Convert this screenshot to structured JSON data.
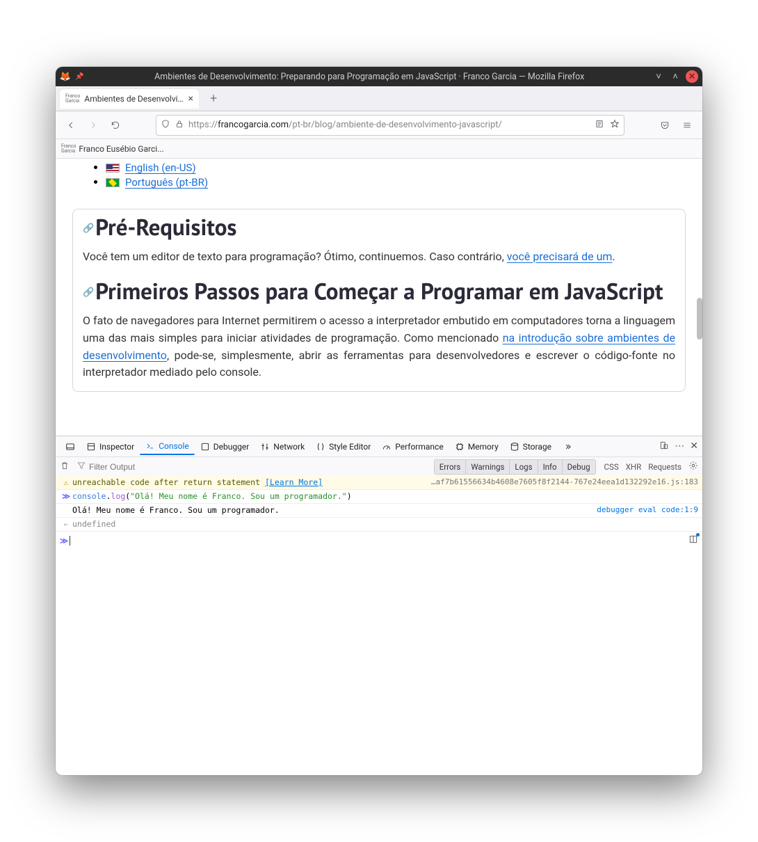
{
  "window": {
    "title": "Ambientes de Desenvolvimento: Preparando para Programação em JavaScript · Franco Garcia — Mozilla Firefox"
  },
  "tab": {
    "title": "Ambientes de Desenvolvimen",
    "favicon_label": "Franco Garcia"
  },
  "url": {
    "pre": "https://",
    "host": "francogarcia.com",
    "path": "/pt-br/blog/ambiente-de-desenvolvimento-javascript/"
  },
  "bookmark": {
    "label": "Franco Eusébio Garci..."
  },
  "languages": {
    "en": "English (en-US)",
    "pt": "Português (pt-BR)"
  },
  "article": {
    "h1a": "Pré-Requisitos",
    "p1_a": "Você tem um editor de texto para programação? Ótimo, continuemos. Caso contrário, ",
    "p1_link": "você precisará de um",
    "p1_b": ".",
    "h1b": "Primeiros Passos para Começar a Programar em JavaScript",
    "p2_a": "O fato de navegadores para Internet permitirem o acesso a interpretador embutido em computadores torna a linguagem uma das mais simples para iniciar atividades de programação. Como mencionado ",
    "p2_link1": "na introdução sobre ambientes de desenvolvimento",
    "p2_b": ", pode-se, simplesmente, abrir as ferramentas para desenvolvedores e escrever o código-fonte no interpretador mediado pelo console."
  },
  "devtools": {
    "panels": {
      "inspector": "Inspector",
      "console": "Console",
      "debugger": "Debugger",
      "network": "Network",
      "style": "Style Editor",
      "performance": "Performance",
      "memory": "Memory",
      "storage": "Storage"
    },
    "filter_placeholder": "Filter Output",
    "toggles": {
      "errors": "Errors",
      "warnings": "Warnings",
      "logs": "Logs",
      "info": "Info",
      "debug": "Debug"
    },
    "links": {
      "css": "CSS",
      "xhr": "XHR",
      "requests": "Requests"
    }
  },
  "console": {
    "warning_text": "unreachable code after return statement",
    "learn_more": "[Learn More]",
    "warning_source": "…af7b61556634b4608e7605f8f2144-767e24eea1d132292e16.js:183",
    "input_obj": "console",
    "input_method": "log",
    "input_str": "\"Olá! Meu nome é Franco. Sou um programador.\"",
    "output": "Olá! Meu nome é Franco. Sou um programador.",
    "output_source": "debugger eval code:1:9",
    "return_value": "undefined"
  }
}
